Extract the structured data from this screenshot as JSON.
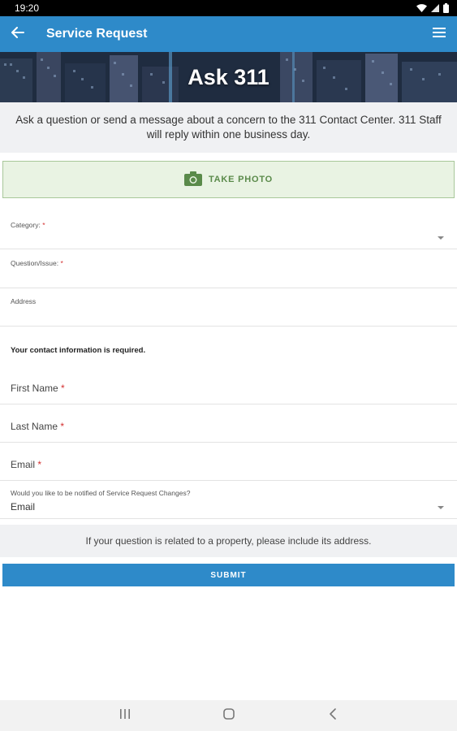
{
  "status_bar": {
    "time": "19:20",
    "icons": [
      "wifi-icon",
      "signal-icon",
      "battery-icon"
    ]
  },
  "app_bar": {
    "title": "Service Request",
    "icons": [
      "arrow-left-icon",
      "hamburger-menu-icon"
    ]
  },
  "banner": {
    "title": "Ask 311"
  },
  "intro": {
    "text": "Ask a question or send a message about a concern to the 311 Contact Center. 311 Staff will reply within one business day."
  },
  "photo_button": {
    "label": "TAKE PHOTO",
    "icon": "camera-icon"
  },
  "form": {
    "category": {
      "label": "Category:",
      "required_mark": "*",
      "value": ""
    },
    "question": {
      "label": "Question/Issue:",
      "required_mark": "*",
      "value": ""
    },
    "address": {
      "label": "Address",
      "value": ""
    },
    "contact_note": "Your contact information is required.",
    "first_name": {
      "placeholder": "First Name",
      "required_mark": "*"
    },
    "last_name": {
      "placeholder": "Last Name",
      "required_mark": "*"
    },
    "email": {
      "placeholder": "Email",
      "required_mark": "*"
    },
    "notify": {
      "label": "Would you like to be notified of Service Request Changes?",
      "value": "Email"
    }
  },
  "hint": {
    "text": "If your question is related to a property, please include its address."
  },
  "submit": {
    "label": "SUBMIT"
  },
  "colors": {
    "primary": "#2e8ac9",
    "required": "#d32f2f",
    "photo_bg": "#e9f3e3",
    "photo_text": "#5a8a4a"
  },
  "nav_bar": {
    "icons": [
      "recent-apps-icon",
      "home-icon",
      "back-nav-icon"
    ]
  }
}
